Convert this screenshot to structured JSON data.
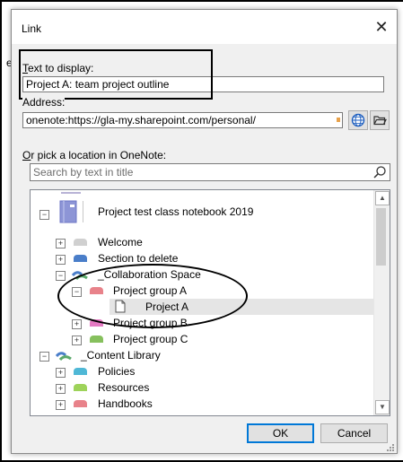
{
  "background_text": "e",
  "dialog": {
    "title": "Link",
    "text_to_display": {
      "label_first": "T",
      "label_rest": "ext to display:",
      "value": "Project A: team project outline"
    },
    "address": {
      "label": "Address:",
      "value": "onenote:https://gla-my.sharepoint.com/personal/"
    },
    "pick_location": {
      "label_first": "O",
      "label_rest": "r pick a location in OneNote:"
    },
    "search": {
      "placeholder": "Search by text in title"
    },
    "tree": {
      "notebook": "Project test class notebook 2019",
      "items": [
        {
          "label": "Welcome",
          "color": "#d0d0d0"
        },
        {
          "label": "Section to delete",
          "color": "#4a7ec9"
        },
        {
          "label": "_Collaboration Space",
          "color": "#5aa96b"
        },
        {
          "label": "Project group A",
          "color": "#e8828a"
        },
        {
          "label": "Project A",
          "color": ""
        },
        {
          "label": "Project group B",
          "color": "#e57ac3"
        },
        {
          "label": "Project group C",
          "color": "#86c05d"
        },
        {
          "label": "_Content Library",
          "color": "#5aa96b"
        },
        {
          "label": "Policies",
          "color": "#4fb8d6"
        },
        {
          "label": "Resources",
          "color": "#9ed35a"
        },
        {
          "label": "Handbooks",
          "color": "#e8828a"
        }
      ],
      "expanders": {
        "collapsed": "+",
        "expanded": "−"
      }
    },
    "buttons": {
      "ok": "OK",
      "cancel": "Cancel"
    },
    "icons": {
      "close": "close-icon",
      "globe": "globe-icon",
      "folder": "folder-icon",
      "search": "search-icon",
      "page": "page-icon",
      "scroll_up": "scroll-up-icon",
      "scroll_down": "scroll-down-icon"
    }
  }
}
